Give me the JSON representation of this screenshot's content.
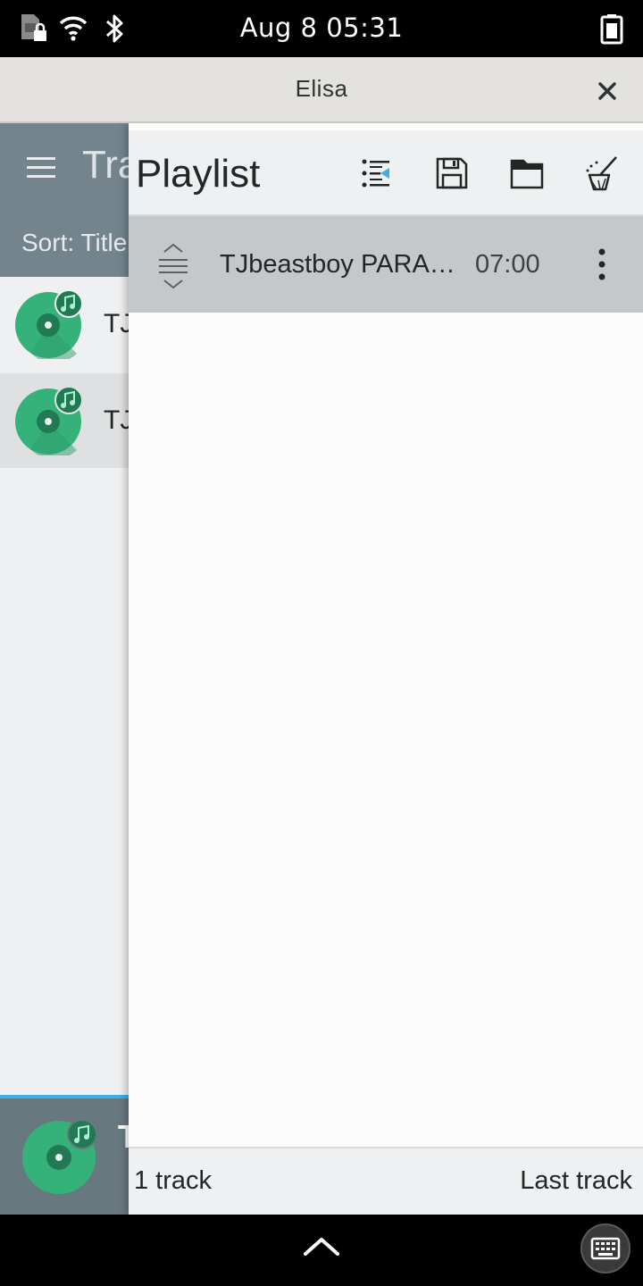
{
  "status_bar": {
    "clock": "Aug 8  05:31",
    "icons": [
      "sim-locked-icon",
      "wifi-icon",
      "bluetooth-icon",
      "battery-icon"
    ]
  },
  "window": {
    "title": "Elisa",
    "close_icon": "close-icon"
  },
  "tracks_view": {
    "title": "Tracks",
    "sort_label": "Sort: Title",
    "rows": [
      {
        "text": "TJ"
      },
      {
        "text": "TJ"
      }
    ],
    "now_playing_text": "T"
  },
  "playlist": {
    "title": "Playlist",
    "toolbar_icons": [
      "show-current-track-icon",
      "save-playlist-icon",
      "open-playlist-icon",
      "clear-playlist-icon"
    ],
    "tracks": [
      {
        "title": "TJbeastboy PARA…",
        "duration": "07:00"
      }
    ],
    "footer": {
      "count": "1 track",
      "position": "Last track"
    }
  },
  "colors": {
    "accent": "#3daee9",
    "disc_green": "#35b27a",
    "selected_row": "#c5c8ca"
  }
}
